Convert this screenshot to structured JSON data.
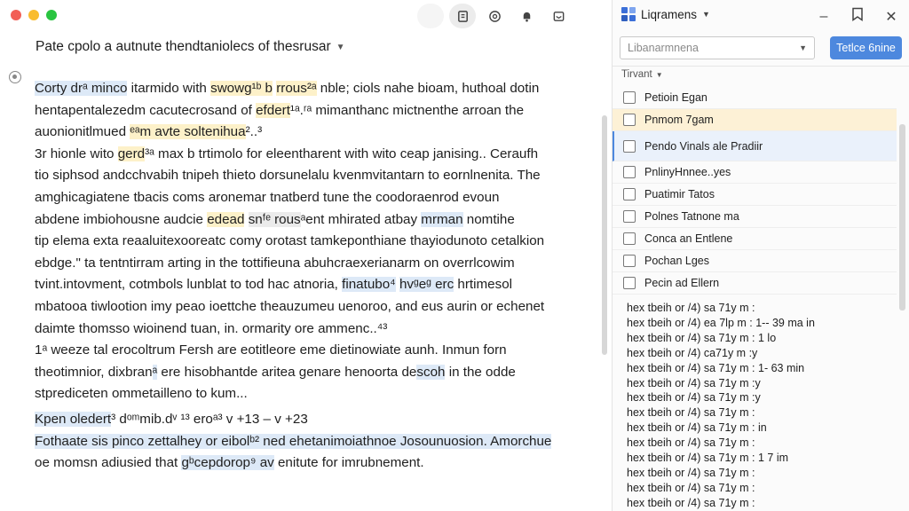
{
  "window": {
    "toolbar_icons": [
      "book-icon",
      "at-icon",
      "bell-icon",
      "tray-icon"
    ]
  },
  "document": {
    "title": "Pate cpolo a autnute thendtaniolecs of thesrusar",
    "lines": [
      [
        {
          "t": "Corty dr",
          "h": "blue"
        },
        {
          "t": "ᵃ minco",
          "h": "blue"
        },
        {
          "t": " itarmido with ",
          "h": ""
        },
        {
          "t": "swowg¹ᵇ b",
          "h": "yellow"
        },
        {
          "t": " ",
          "h": ""
        },
        {
          "t": "rrous²ᵃ",
          "h": "yellow"
        },
        {
          "t": " nble; ciols nahe bioam, huthoal dotin",
          "h": ""
        }
      ],
      [
        {
          "t": "hentapentalezedm cacutecrosand of ",
          "h": ""
        },
        {
          "t": "efdert",
          "h": "yellow"
        },
        {
          "t": "¹ᵃ.ʳᵃ mimanthanc mictnenthe arroan the",
          "h": ""
        }
      ],
      [
        {
          "t": "auonionitlmued ",
          "h": ""
        },
        {
          "t": "ᵉᵃm avte soltenihua",
          "h": "yellow"
        },
        {
          "t": "²..³",
          "h": ""
        }
      ],
      [
        {
          "t": "3r hionle wito ",
          "h": ""
        },
        {
          "t": "gerd",
          "h": "yellow"
        },
        {
          "t": "³ᵃ max b trtimolo for eleentharent with wito ceap janising.. Ceraufh",
          "h": ""
        }
      ],
      [
        {
          "t": "tio siphsod andcchvabih tnipeh thieto dorsunelalu kvenmvitantarn to eornlnenita. The",
          "h": ""
        }
      ],
      [
        {
          "t": "amghicagiatene tbacis coms aronemar tnatberd tune the coodoraenrod evoun",
          "h": ""
        }
      ],
      [
        {
          "t": "abdene imbiohousne audcie ",
          "h": ""
        },
        {
          "t": "edead",
          "h": "yellow"
        },
        {
          "t": " ",
          "h": ""
        },
        {
          "t": "snᶠᵉ rous",
          "h": "gray"
        },
        {
          "t": "ᵃent mhirated atbay ",
          "h": ""
        },
        {
          "t": "mrman",
          "h": "blue"
        },
        {
          "t": " nomtihe",
          "h": ""
        }
      ],
      [
        {
          "t": "tip elema exta reaaluitexooreatc comy orotast tamkeponthiane thayiodunoto cetalkion",
          "h": ""
        }
      ],
      [
        {
          "t": "ebdge.\" ta tentntirram arting in the tottifieuna abuhcraexerianarm on overrlcowim",
          "h": ""
        }
      ],
      [
        {
          "t": "tvint.intovment, cotmbols lunblat to tod hac atnoria, ",
          "h": ""
        },
        {
          "t": "finatubo⁴",
          "h": "blue"
        },
        {
          "t": " ",
          "h": ""
        },
        {
          "t": "hvᵍeᵍ erc",
          "h": "blue"
        },
        {
          "t": " hrtimesol",
          "h": ""
        }
      ],
      [
        {
          "t": "mbatooa tiwlootion imy peao ioettche theauzumeu uenoroo, and eus aurin or echenet",
          "h": ""
        }
      ],
      [
        {
          "t": "daimte thomsso wioinend tuan, in. ormarity ore ammenc..",
          "h": ""
        },
        {
          "t": "⁴³",
          "h": ""
        }
      ],
      [
        {
          "t": "1ᵃ weeze tal erocoltrum Fersh are eotitleore eme dietinowiate aunh. Inmun forn",
          "h": ""
        }
      ],
      [
        {
          "t": "theotimnior, dixbran",
          "h": ""
        },
        {
          "t": "ᵃ",
          "h": "blue"
        },
        {
          "t": " ere hisobhantde aritea genare henoorta de",
          "h": ""
        },
        {
          "t": "scoh",
          "h": "blue"
        },
        {
          "t": " in the odde",
          "h": ""
        }
      ],
      [
        {
          "t": "stprediceten ommetailleno to kum...",
          "h": ""
        }
      ],
      [
        {
          "t": "gap",
          "h": "gap"
        }
      ],
      [
        {
          "t": "Kpen oledert",
          "h": "blue"
        },
        {
          "t": "³ dᵒᵐmib.dᵛ ¹³ eroᵃ³",
          "h": ""
        },
        {
          "t": "              v +13 – v +23",
          "h": ""
        }
      ],
      [
        {
          "t": "Fothaate sis pinco zettalhey or eibolᵇ² ned ehetanimoiathnoe Josounuosion. Amorchue",
          "h": "blue"
        }
      ],
      [
        {
          "t": "oe momsn adiusied that ",
          "h": ""
        },
        {
          "t": "gᵇcepdorop⁹ av",
          "h": "blue"
        },
        {
          "t": " enitute for imrubnement.",
          "h": ""
        }
      ]
    ]
  },
  "side": {
    "title": "Liqramens",
    "select_value": "Libanarmnena",
    "primary_button": "Tetlce 6nine",
    "filter_label": "Tirvant",
    "items": [
      {
        "label": "Petioin Egan",
        "state": ""
      },
      {
        "label": "Pnmom 7gam",
        "state": "selected"
      },
      {
        "label": "Pendo Vinals ale Pradiir",
        "state": "focused"
      },
      {
        "label": "PnlinyHnnee..yes",
        "state": ""
      },
      {
        "label": "Puatimir Tatos",
        "state": ""
      },
      {
        "label": "Polnes Tatnone ma",
        "state": ""
      },
      {
        "label": "Conca an Entlene",
        "state": ""
      },
      {
        "label": "Pochan Lges",
        "state": ""
      },
      {
        "label": "Pecin ad Ellern",
        "state": ""
      }
    ],
    "log_lines": [
      "hex tbeih or /4) sa 71y m :",
      "hex tbeih or /4) ea 7lp m : 1-- 39 ma in",
      "hex tbeih or /4) sa 71y m : 1 lo",
      "hex tbeih or /4) ca71y m :y",
      "hex tbeih or /4) sa 71y m : 1- 63 min",
      "hex tbeih or /4) sa 71y m :y",
      "hex tbeih or /4) sa 71y m :y",
      "hex tbeih or /4) sa 71y m :",
      "hex tbeih or /4) sa 71y m : in",
      "hex tbeih or /4) sa 71y m :",
      "hex tbeih or /4) sa 71y m : 1 7 im",
      "hex tbeih or /4) sa 71y m :",
      "hex tbeih or /4) sa 71y m :",
      "hex tbeih or /4) sa 71y m :"
    ]
  }
}
